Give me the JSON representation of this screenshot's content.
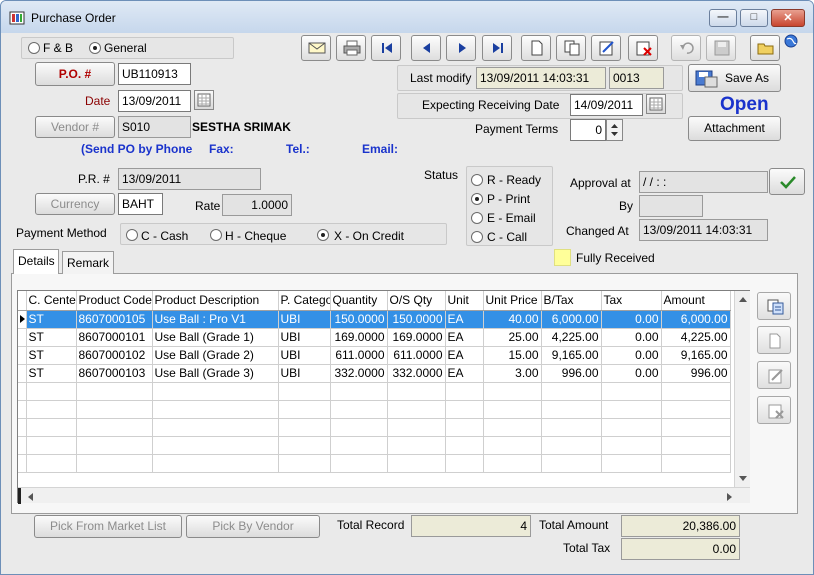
{
  "window": {
    "title": "Purchase Order",
    "min_symbol": "—",
    "max_symbol": "□",
    "close_symbol": "✕"
  },
  "category": {
    "options": [
      "F & B",
      "General"
    ],
    "selected": "General"
  },
  "header": {
    "po_button": "P.O. #",
    "po_number": "UB110913",
    "date_label": "Date",
    "date_value": "13/09/2011",
    "vendor_button": "Vendor #",
    "vendor_code": "S010",
    "vendor_name": "SESTHA  SRIMAK",
    "send_po_text": "(Send PO by Phone",
    "fax_label": "Fax:",
    "tel_label": "Tel.:",
    "email_label": "Email:",
    "pr_label": "P.R. #",
    "pr_value": "13/09/2011",
    "currency_button": "Currency",
    "currency_value": "BAHT",
    "rate_label": "Rate",
    "rate_value": "1.0000",
    "payment_method_label": "Payment Method",
    "payment_methods": [
      "C - Cash",
      "H - Cheque",
      "X - On Credit"
    ],
    "payment_method_selected": "X - On Credit"
  },
  "right_panel": {
    "last_modify_label": "Last modify",
    "last_modify_date": "13/09/2011 14:03:31",
    "last_modify_user": "0013",
    "expecting_label": "Expecting Receiving Date",
    "expecting_date": "14/09/2011",
    "payment_terms_label": "Payment Terms",
    "payment_terms_value": "0",
    "save_as_label": "Save As",
    "open_status": "Open",
    "attachment_label": "Attachment",
    "status_label": "Status",
    "statuses": [
      "R - Ready",
      "P - Print",
      "E - Email",
      "C - Call"
    ],
    "status_selected": "P - Print",
    "approval_label": "Approval at",
    "approval_value": " /  /       :  :",
    "by_label": "By",
    "by_value": "",
    "changed_label": "Changed At",
    "changed_value": "13/09/2011 14:03:31",
    "fully_received_label": "Fully Received"
  },
  "tabs": [
    "Details",
    "Remark"
  ],
  "active_tab": "Details",
  "grid": {
    "columns": [
      "C. Center",
      "Product Code",
      "Product Description",
      "P. Category",
      "Quantity",
      "O/S Qty",
      "Unit",
      "Unit Price",
      "B/Tax",
      "Tax",
      "Amount"
    ],
    "rows": [
      [
        "ST",
        "8607000105",
        "Use Ball : Pro V1",
        "UBI",
        "150.0000",
        "150.0000",
        "EA",
        "40.00",
        "6,000.00",
        "0.00",
        "6,000.00"
      ],
      [
        "ST",
        "8607000101",
        "Use Ball (Grade 1)",
        "UBI",
        "169.0000",
        "169.0000",
        "EA",
        "25.00",
        "4,225.00",
        "0.00",
        "4,225.00"
      ],
      [
        "ST",
        "8607000102",
        "Use Ball (Grade 2)",
        "UBI",
        "611.0000",
        "611.0000",
        "EA",
        "15.00",
        "9,165.00",
        "0.00",
        "9,165.00"
      ],
      [
        "ST",
        "8607000103",
        "Use Ball (Grade 3)",
        "UBI",
        "332.0000",
        "332.0000",
        "EA",
        "3.00",
        "996.00",
        "0.00",
        "996.00"
      ]
    ],
    "selected_row": 0
  },
  "footer": {
    "pick_market_label": "Pick From Market List",
    "pick_vendor_label": "Pick By Vendor",
    "total_record_label": "Total Record",
    "total_record_value": "4",
    "total_amount_label": "Total Amount",
    "total_amount_value": "20,386.00",
    "total_tax_label": "Total Tax",
    "total_tax_value": "0.00"
  },
  "colors": {
    "accent_blue": "#1a33cc",
    "selection": "#3390e6",
    "fully_received_swatch": "#ffff99"
  },
  "icons": {
    "toolbar": [
      "email-icon",
      "print-icon",
      "first-record-icon",
      "previous-record-icon",
      "next-record-icon",
      "last-record-icon",
      "new-document-icon",
      "copy-document-icon",
      "edit-document-icon",
      "delete-document-icon",
      "undo-icon",
      "save-icon",
      "open-folder-icon",
      "globe-icon"
    ],
    "side": [
      "import-rows-icon",
      "new-row-icon",
      "edit-row-icon",
      "delete-row-icon"
    ]
  }
}
